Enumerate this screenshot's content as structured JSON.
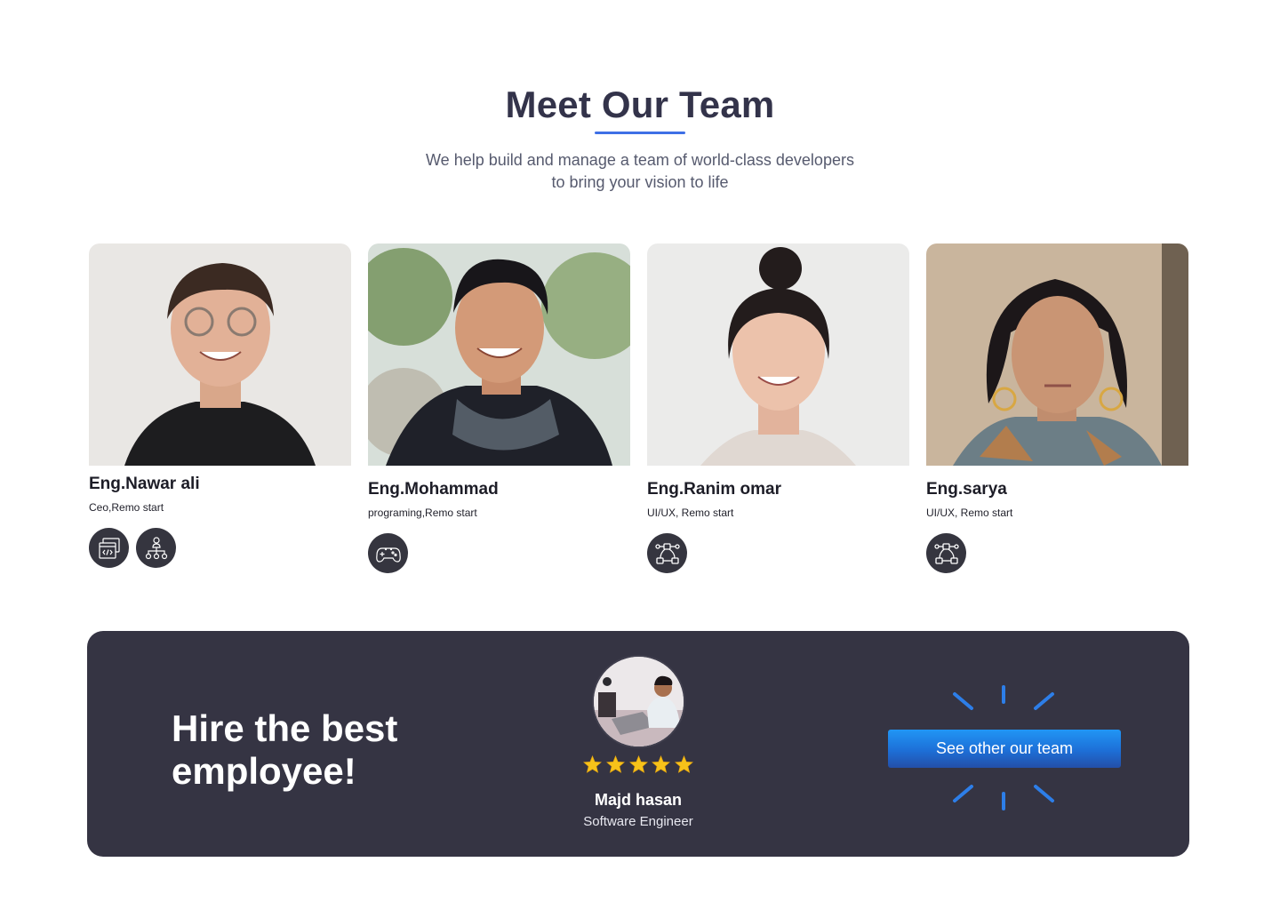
{
  "header": {
    "title": "Meet Our Team",
    "subtitle_line1": "We help build and manage a team of world-class developers",
    "subtitle_line2": "to bring your vision to life"
  },
  "team": [
    {
      "name": "Eng.Nawar ali",
      "role": "Ceo,Remo start",
      "skills": [
        "code-window-icon",
        "org-chart-icon"
      ]
    },
    {
      "name": "Eng.Mohammad",
      "role": "programing,Remo start",
      "skills": [
        "gamepad-icon"
      ]
    },
    {
      "name": "Eng.Ranim omar",
      "role": "UI/UX, Remo start",
      "skills": [
        "vector-path-icon"
      ]
    },
    {
      "name": "Eng.sarya",
      "role": "UI/UX, Remo start",
      "skills": [
        "vector-path-icon"
      ]
    }
  ],
  "banner": {
    "title": "Hire the best employee!",
    "employee_name": "Majd hasan",
    "employee_role": "Software Engineer",
    "rating": 5,
    "cta_label": "See other our team"
  },
  "colors": {
    "accent": "#3e6fe6",
    "banner_bg": "#353443",
    "star": "#f5c518",
    "button": "#1d6fd7"
  }
}
